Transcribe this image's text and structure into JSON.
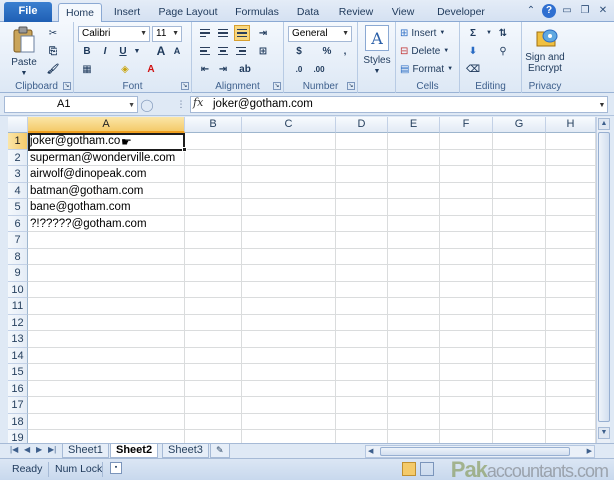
{
  "ribbon_tabs": [
    "File",
    "Home",
    "Insert",
    "Page Layout",
    "Formulas",
    "Data",
    "Review",
    "View",
    "Developer"
  ],
  "groups": {
    "clipboard": {
      "label": "Clipboard",
      "paste": "Paste"
    },
    "font": {
      "label": "Font",
      "font_name": "Calibri",
      "font_size": "11"
    },
    "alignment": {
      "label": "Alignment"
    },
    "number": {
      "label": "Number",
      "format": "General",
      "currency": "$",
      "percent": "%",
      "comma": ","
    },
    "styles": {
      "label": "Styles",
      "button": "Styles"
    },
    "cells": {
      "label": "Cells",
      "insert": "Insert",
      "delete": "Delete",
      "format": "Format"
    },
    "editing": {
      "label": "Editing",
      "sum": "Σ"
    },
    "privacy": {
      "label": "Privacy",
      "sign_line1": "Sign and",
      "sign_line2": "Encrypt"
    }
  },
  "formula_bar": {
    "name_box": "A1",
    "fx": "fx",
    "formula": "joker@gotham.com"
  },
  "columns": [
    "A",
    "B",
    "C",
    "D",
    "E",
    "F",
    "G",
    "H"
  ],
  "rows": [
    "1",
    "2",
    "3",
    "4",
    "5",
    "6",
    "7",
    "8",
    "9",
    "10",
    "11",
    "12",
    "13",
    "14",
    "15",
    "16",
    "17",
    "18",
    "19"
  ],
  "cells_a": [
    "joker@gotham.co",
    "superman@wonderville.com",
    "airwolf@dinopeak.com",
    "batman@gotham.com",
    "bane@gotham.com",
    "?!?????@gotham.com"
  ],
  "sheets": [
    "Sheet1",
    "Sheet2",
    "Sheet3"
  ],
  "active_sheet": "Sheet2",
  "status": {
    "ready": "Ready",
    "num_lock": "Num Lock"
  },
  "watermark": {
    "brand": "Pak",
    "rest": "accountants.com"
  },
  "colors": {
    "file_tab": "#2a6cc4",
    "selection_header": "#f4ca6a",
    "grid_line": "#dadcdd"
  }
}
